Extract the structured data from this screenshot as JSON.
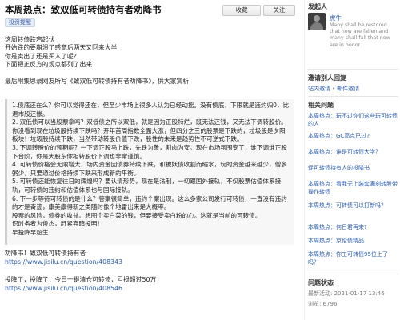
{
  "question": {
    "title": "本周热点：致双低可转债持有者劝降书",
    "collect_label": "收藏",
    "follow_label": "关注",
    "tag": "投资提醒"
  },
  "intro_lines": [
    "这周转债跌宕起伏",
    "开始跌的要崩溃了感觉后两天又回来大半",
    "你是卖出了还是买入了呢?",
    "下面把正反方的观点都列了出来"
  ],
  "quote_intro": "最后附集思录网友所写《致双低可转债持有者劝降书》，供大家赏析",
  "quote_paragraphs": [
    "1.债底还在么？你可以觉得还在，但至少市场上很多人认为已经动摇。没有债底，下限就是违约归0，比退市股还惨。",
    "2. 双低债可以当股票拿吗？双低债之所以双低，就是因为正股特烂，既无法还钱，又无法下调转股价。你没看到现在垃圾股持续下跌吗？开年首周指数全面大涨，但四分之三的股票是下跌的，垃圾股是夕阳板块！垃圾股持续下跌，当然带动转股价值下跌，股性的未来是趋势性不可逆式下跌。",
    "3. 下调转股价的预期呢？一下调正股马上跌，先跌为敬，割肉为安。现在市场氛围变了，谁下调谁正股下台阶，你是大股东你相转股价下调也非常谨慎。",
    "4. 可转债价格会无限增大，场内资金因债券持续下跌，和被妖债收割而缩水，玩的资金越来越少，僧多粥少，只要通过价格持续下跌来形成新的平衡。",
    "5. 可转债还能恢复往日的辉煌吗？要认清形势，现在是法制，一切跟国外接轨，不仅股票估值体系接轨，可转债的违约和估值体系也与国际接轨。",
    "6. 下一步等待可转债的是什么？答案很简单，违约个案出现。这么多家公司发行可转债，一直没有违约的才是奇迹，康美康得新之类随时像个地雷出来是大概率。",
    "股票的风险，债券的收益。想图个卖白菜的钱，但要接受卖白粉的心。这就是当前的可转债。",
    "识时务者为俊杰，赶紧弃暗投明！",
    "早投降早超生！"
  ],
  "after_lines": [
    "劝降书！致双低可转债持有者",
    "https://www.jisilu.cn/question/408343",
    "",
    "投降了，投降了，今日一键清仓可转债，亏损超过50万",
    "https://www.jisilu.cn/question/408546"
  ],
  "sidebar": {
    "initiator_heading": "发起人",
    "user_name": "虎牛",
    "user_quote": "Many shall be restored that now are fallen and many shall fall that now are in honor",
    "invite_heading": "邀请别人回复",
    "invite_links": [
      "站内邀请",
      "邮件邀请"
    ],
    "related_heading": "相关问题",
    "related": [
      {
        "text": "本周热点：玩不过你们这些玩可转债的人",
        "user": ""
      },
      {
        "text": "本周热点：GC高点已过?",
        "user": ""
      },
      {
        "text": "本周热点：谁是可转债大学？",
        "user": ""
      },
      {
        "text": "促可转债持有人的投降书",
        "user": ""
      },
      {
        "text": "本周热点：看我无上装套满刻转股带操作转债",
        "user": ""
      },
      {
        "text": "本周热点：可转债可以打新吗？",
        "user": ""
      },
      {
        "text": "本周热点：何日君再来?",
        "user": ""
      },
      {
        "text": "本周热点：京伦债精品",
        "user": ""
      },
      {
        "text": "本周热点：你工可转债95位上了吗？",
        "user": ""
      }
    ],
    "status_heading": "问题状态",
    "last_update_label": "最新活动:",
    "last_update_value": "2021-01-17 13:46",
    "views_label": "浏览:",
    "views_value": "6796"
  }
}
